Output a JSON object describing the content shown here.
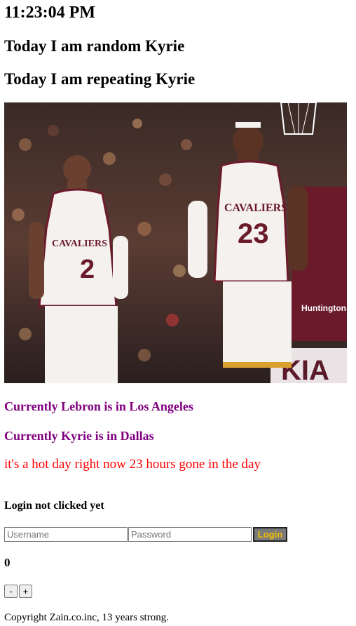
{
  "clock": {
    "time": "11:23:04 PM"
  },
  "headings": {
    "random": "Today I am random Kyrie",
    "repeating": "Today I am repeating Kyrie"
  },
  "photo": {
    "jersey_left_team": "CAVALIERS",
    "jersey_left_number": "2",
    "jersey_right_team": "CAVALIERS",
    "jersey_right_number": "23",
    "sponsor_text": "Huntington",
    "banner_text": "KIA"
  },
  "locations": {
    "lebron": "Currently Lebron is in Los Angeles",
    "kyrie": "Currently Kyrie is in Dallas"
  },
  "weather": {
    "text": "it's a hot day right now 23 hours gone in the day"
  },
  "login": {
    "status": "Login not clicked yet",
    "username_placeholder": "Username",
    "password_placeholder": "Password",
    "button_label": "Login"
  },
  "counter": {
    "value": "0",
    "decrement_label": "-",
    "increment_label": "+"
  },
  "footer": {
    "copyright": "Copyright Zain.co.inc, 13 years strong."
  },
  "colors": {
    "purple": "#800080",
    "red": "#ff0000",
    "login_text": "#f0c000",
    "wine": "#6b1a2a"
  }
}
